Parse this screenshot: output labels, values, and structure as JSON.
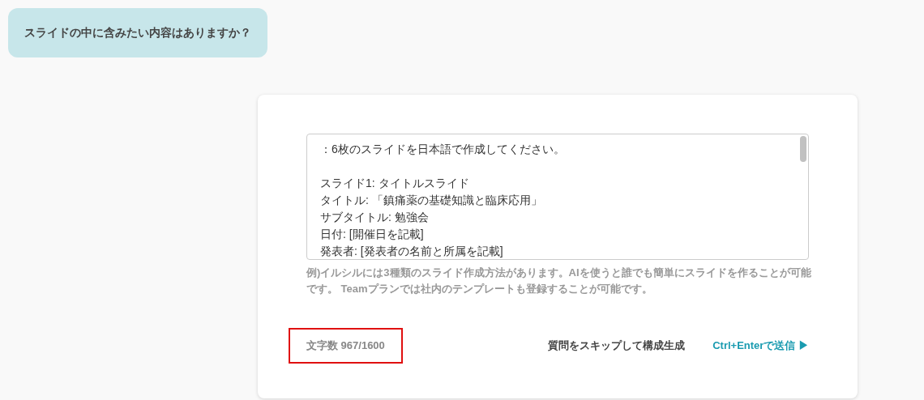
{
  "question": {
    "text": "スライドの中に含みたい内容はありますか？"
  },
  "answer": {
    "paragraphs": [
      [
        "：6枚のスライドを日本語で作成してください。"
      ],
      [
        "スライド1: タイトルスライド",
        "タイトル: 「鎮痛薬の基礎知識と臨床応用」",
        "サブタイトル: 勉強会",
        "日付: [開催日を記載]",
        "発表者: [発表者の名前と所属を記載]"
      ]
    ],
    "hint": "例)イルシルには3種類のスライド作成方法があります。AIを使うと誰でも簡単にスライドを作ることが可能です。 Teamプランでは社内のテンプレートも登録することが可能です。"
  },
  "counter": {
    "text": "文字数 967/1600",
    "highlighted": true
  },
  "skip_button": "質問をスキップして構成生成",
  "send_button": "Ctrl+Enterで送信 ▶"
}
